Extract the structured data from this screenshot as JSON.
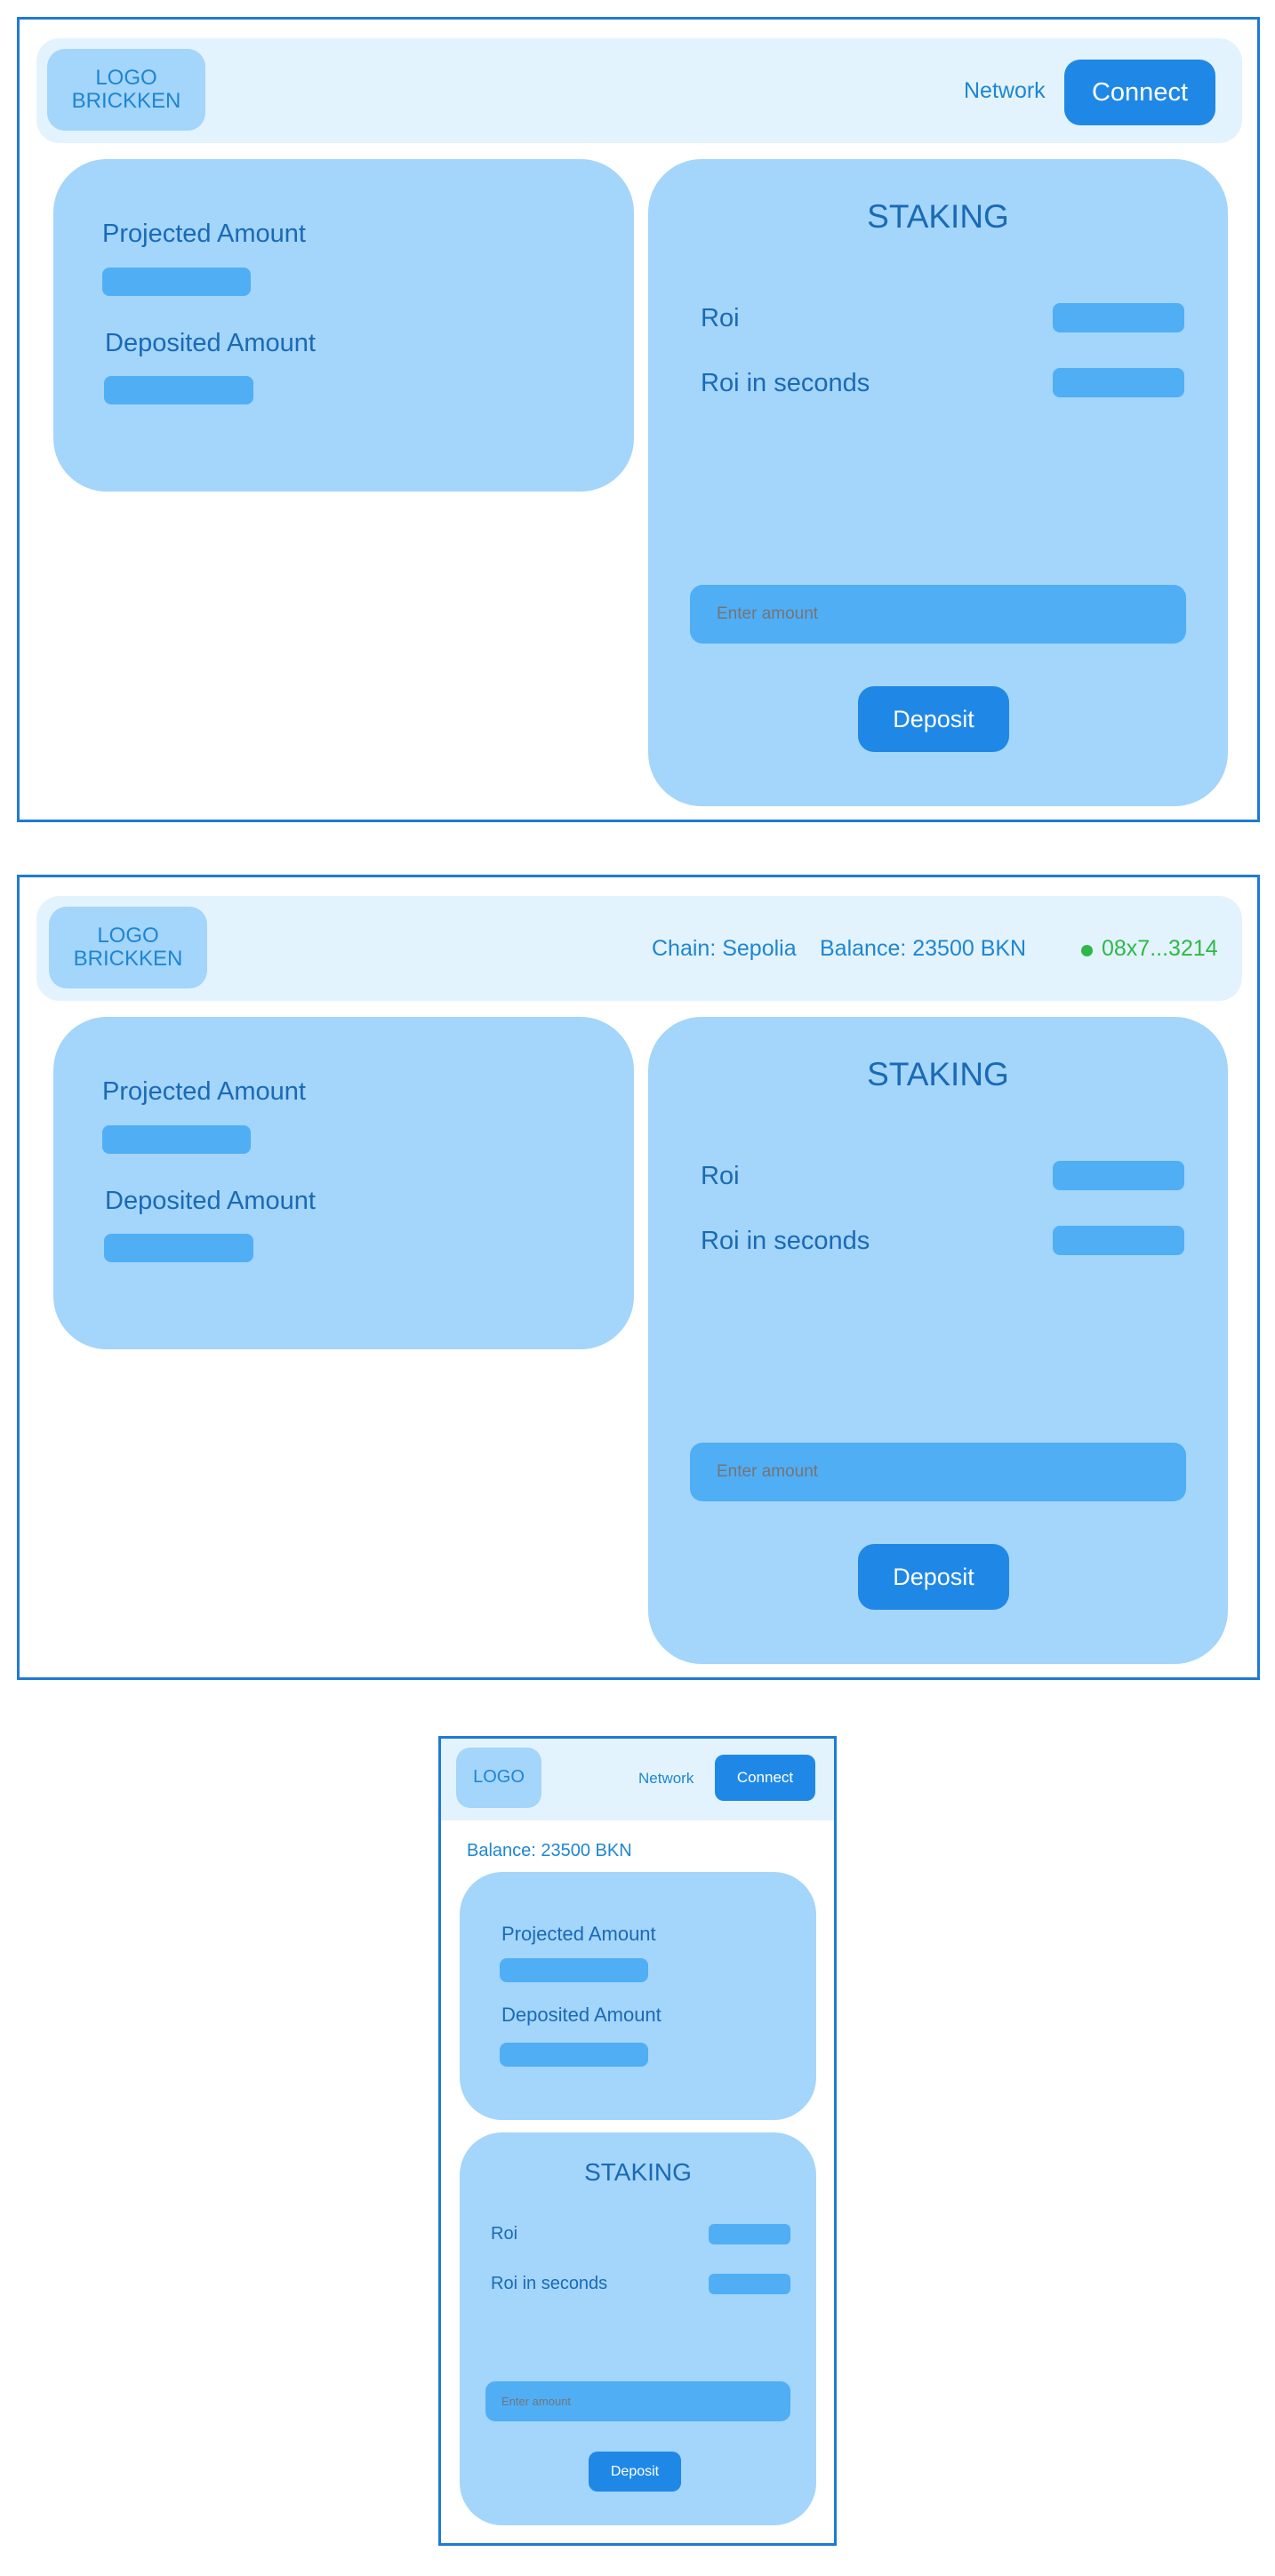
{
  "colors": {
    "frame": "#1f7ad6",
    "header": "#e3f3fd",
    "card": "#a4d5fb",
    "field": "#50aef5",
    "button": "#1f88e6",
    "text": "#1a6ab5",
    "connected": "#2fb848"
  },
  "icons": {
    "status_dot": "green-dot-icon"
  },
  "mockup1": {
    "logo_line1": "LOGO",
    "logo_line2": "BRICKKEN",
    "network_label": "Network",
    "connect_label": "Connect",
    "projected_label": "Projected Amount",
    "deposited_label": "Deposited Amount",
    "staking_title": "STAKING",
    "roi_label": "Roi",
    "roi_seconds_label": "Roi in seconds",
    "amount_placeholder": "Enter amount",
    "deposit_label": "Deposit"
  },
  "mockup2": {
    "logo_line1": "LOGO",
    "logo_line2": "BRICKKEN",
    "chain_label": "Chain: Sepolia",
    "balance_label": "Balance: 23500 BKN",
    "address_label": "08x7...3214",
    "projected_label": "Projected Amount",
    "deposited_label": "Deposited Amount",
    "staking_title": "STAKING",
    "roi_label": "Roi",
    "roi_seconds_label": "Roi in seconds",
    "amount_placeholder": "Enter amount",
    "deposit_label": "Deposit"
  },
  "mockup3": {
    "logo_label": "LOGO",
    "network_label": "Network",
    "connect_label": "Connect",
    "balance_label": "Balance: 23500 BKN",
    "projected_label": "Projected Amount",
    "deposited_label": "Deposited Amount",
    "staking_title": "STAKING",
    "roi_label": "Roi",
    "roi_seconds_label": "Roi in seconds",
    "amount_placeholder": "Enter amount",
    "deposit_label": "Deposit"
  }
}
